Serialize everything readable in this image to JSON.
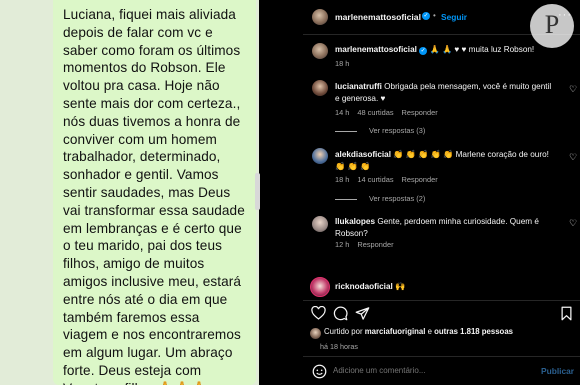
{
  "chat": {
    "message": "Luciana, fiquei mais aliviada\ndepois de falar com vc e\nsaber como foram os últimos\nmomentos do Robson.  Ele\nvoltou pra casa. Hoje não\nsente mais dor com certeza.,\nnós duas tivemos a honra de\nconviver com um homem\ntrabalhador, determinado,\nsonhador e gentil. Vamos\nsentir saudades, mas Deus\nvai transformar essa saudade\nem lembranças e é certo que\no teu marido, pai dos teus\nfilhos, amigo de muitos\namigos inclusive meu, estará\nentre nós até o dia em que\ntambém faremos essa\nviagem e nos encontraremos\nem algum lugar. Um abraço\nforte. Deus esteja com\nVc e teus filhos🙏🙏🙏",
    "chevron": "⌄"
  },
  "post": {
    "author": "marlenemattosoficial",
    "dot": "•",
    "follow_label": "Seguir",
    "more": "···",
    "caption_user": "marlenemattosoficial",
    "caption_text": "🙏 🙏 ♥ ♥  muita luz Robson!",
    "caption_time": "18 h"
  },
  "comments": [
    {
      "user": "lucianatruffi",
      "text": "Obrigada pela mensagem, você é muito gentil e generosa. ♥",
      "time": "14 h",
      "likes": "48 curtidas",
      "reply": "Responder",
      "replies": "Ver respostas (3)"
    },
    {
      "user": "alekdiasoficial",
      "text": "👏 👏 👏 👏 👏  Marlene coração de ouro! 👏 👏 👏",
      "time": "18 h",
      "likes": "14 curtidas",
      "reply": "Responder",
      "replies": "Ver respostas (2)"
    },
    {
      "user": "llukalopes",
      "text": "Gente, perdoem minha curiosidade. Quem é Robson?",
      "time": "12 h",
      "reply": "Responder"
    },
    {
      "user": "ricknodaoficial",
      "text": "🙌"
    }
  ],
  "footer": {
    "liked_prefix": "Curtido por",
    "liked_user": "marciafuoriginal",
    "liked_mid": "e",
    "liked_count": "outras 1.818 pessoas",
    "ago": "há 18 horas",
    "comment_placeholder": "Adicione um comentário...",
    "post_label": "Publicar"
  },
  "watermark": "P"
}
